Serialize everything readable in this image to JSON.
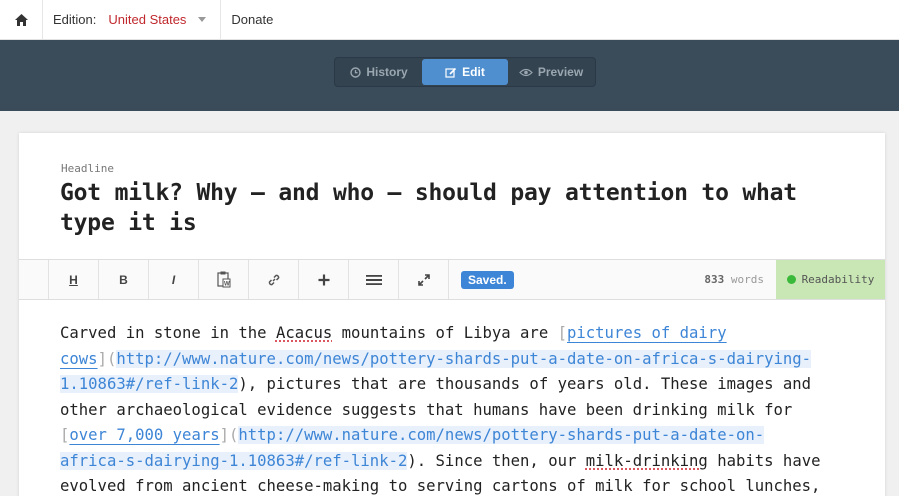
{
  "topbar": {
    "edition_label": "Edition:",
    "edition_value": "United States",
    "donate": "Donate"
  },
  "modes": {
    "history": "History",
    "edit": "Edit",
    "preview": "Preview"
  },
  "headline": {
    "label": "Headline",
    "text": "Got milk? Why — and who — should pay attention to what type it is"
  },
  "toolbar": {
    "heading": "H",
    "bold": "B",
    "italic": "I",
    "saved": "Saved.",
    "word_count": "833",
    "words_label": "words",
    "readability": "Readability"
  },
  "body": {
    "l1a": "Carved in stone in the ",
    "l1b": "Acacus",
    "l1c": " mountains of Libya are ",
    "l1d": "[",
    "l1e": "pictures of dairy",
    "l2a": "cows",
    "l2b": "](",
    "l2c": "http://www.nature.com/news/pottery-shards-put-a-date-on-africa-s-dairying-",
    "l3a": "1.10863#/ref-link-2",
    "l3b": "), pictures that are thousands of years old. These images and",
    "l4": "other archaeological evidence suggests that humans have been drinking milk for",
    "l5a": "[",
    "l5b": "over 7,000 years",
    "l5c": "](",
    "l5d": "http://www.nature.com/news/pottery-shards-put-a-date-on-",
    "l6a": "africa-s-dairying-1.10863#/ref-link-2",
    "l6b": "). Since then, our ",
    "l6c": "milk-drinking",
    "l6d": " habits have",
    "l7": "evolved from ancient cheese-making to serving cartons of milk for school lunches,"
  }
}
